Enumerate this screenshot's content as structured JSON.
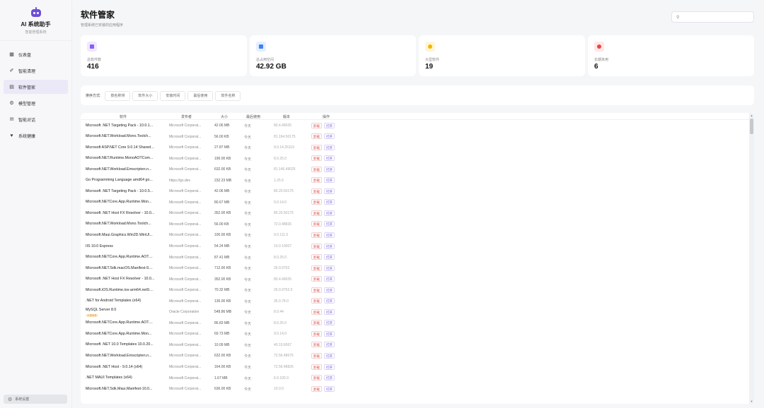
{
  "brand": {
    "title": "AI 系统助手",
    "subtitle": "智能管理系统"
  },
  "sidebar": {
    "items": [
      {
        "label": "仪表盘",
        "icon": "dashboard-icon",
        "active": false
      },
      {
        "label": "智能清理",
        "icon": "broom-icon",
        "active": false
      },
      {
        "label": "软件管家",
        "icon": "package-icon",
        "active": true
      },
      {
        "label": "模型管理",
        "icon": "model-icon",
        "active": false
      },
      {
        "label": "智能对话",
        "icon": "chat-icon",
        "active": false
      },
      {
        "label": "系统健康",
        "icon": "heartbeat-icon",
        "active": false
      }
    ],
    "settings_label": "系统设置"
  },
  "header": {
    "title": "软件管家",
    "subtitle": "管理系统已安装的应用程序"
  },
  "search": {
    "placeholder": ""
  },
  "stats": [
    {
      "label": "总软件数",
      "value": "416",
      "icon": "software-count-icon",
      "color": "#8b5cf6",
      "bg": "#efe9fd"
    },
    {
      "label": "总占用空间",
      "value": "42.92 GB",
      "icon": "disk-usage-icon",
      "color": "#3b82f6",
      "bg": "#e6efff"
    },
    {
      "label": "大型软件",
      "value": "19",
      "icon": "large-software-icon",
      "color": "#f5b400",
      "bg": "#fff5d9"
    },
    {
      "label": "长期未用",
      "value": "6",
      "icon": "unused-software-icon",
      "color": "#ef4444",
      "bg": "#fde8e8"
    }
  ],
  "filter": {
    "label": "排序方式:",
    "options": [
      "按名称排",
      "软件大小",
      "安装时间",
      "最后使用",
      "软件名称"
    ]
  },
  "table": {
    "headers": [
      "软件",
      "发布者",
      "大小",
      "最后使用",
      "版本",
      "操作"
    ],
    "uninstall_label": "卸载",
    "open_label": "打开",
    "rows": [
      {
        "name": "Microsoft .NET Targeting Pack - 10.0.1...",
        "publisher": "Microsoft Corporat...",
        "size": "42.06 MB",
        "last_used": "今天",
        "version": "80.4.49025"
      },
      {
        "name": "Microsoft.NET.Workload.Mono.Toolch...",
        "publisher": "Microsoft Corporat...",
        "size": "56.00 KB",
        "last_used": "今天",
        "version": "81.164.50175"
      },
      {
        "name": "Microsoft ASP.NET Core 9.0.14 Shared...",
        "publisher": "Microsoft Corporat...",
        "size": "27.87 MB",
        "last_used": "今天",
        "version": "9.0.14.26119"
      },
      {
        "name": "Microsoft.NET.Runtime.MonoAOTCom...",
        "publisher": "Microsoft Corporat...",
        "size": "196.00 KB",
        "last_used": "今天",
        "version": "8.0.25.0"
      },
      {
        "name": "Microsoft.NET.Workload.Emscripten.n...",
        "publisher": "Microsoft Corporat...",
        "size": "632.00 KB",
        "last_used": "今天",
        "version": "81.146.49025"
      },
      {
        "name": "Go Programming Language amd64 go...",
        "publisher": "https://go.dev",
        "size": "232.23 MB",
        "last_used": "今天",
        "version": "1.25.5"
      },
      {
        "name": "Microsoft .NET Targeting Pack - 10.0.5...",
        "publisher": "Microsoft Corporat...",
        "size": "42.06 MB",
        "last_used": "今天",
        "version": "80.20.50175"
      },
      {
        "name": "Microsoft.NETCore.App.Runtime.Mon...",
        "publisher": "Microsoft Corporat...",
        "size": "80.67 MB",
        "last_used": "今天",
        "version": "9.0.14.0"
      },
      {
        "name": "Microsoft .NET Host FX Resolver - 10.0...",
        "publisher": "Microsoft Corporat...",
        "size": "352.00 KB",
        "last_used": "今天",
        "version": "80.20.50175"
      },
      {
        "name": "Microsoft.NET.Workload.Mono.Toolch...",
        "publisher": "Microsoft Corporat...",
        "size": "56.00 KB",
        "last_used": "今天",
        "version": "72.0.48826"
      },
      {
        "name": "Microsoft.Maui.Graphics.Win2D.WinUI...",
        "publisher": "Microsoft Corporat...",
        "size": "100.00 KB",
        "last_used": "今天",
        "version": "9.0.111.0"
      },
      {
        "name": "IIS 10.0 Express",
        "publisher": "Microsoft Corporat...",
        "size": "54.24 MB",
        "last_used": "今天",
        "version": "10.0.10007"
      },
      {
        "name": "Microsoft.NETCore.App.Runtime.AOT....",
        "publisher": "Microsoft Corporat...",
        "size": "87.41 MB",
        "last_used": "今天",
        "version": "8.0.25.0"
      },
      {
        "name": "Microsoft.NET.Sdk.macOS.Manifest-9....",
        "publisher": "Microsoft Corporat...",
        "size": "712.00 KB",
        "last_used": "今天",
        "version": "26.0.9752"
      },
      {
        "name": "Microsoft .NET Host FX Resolver - 10.0...",
        "publisher": "Microsoft Corporat...",
        "size": "352.00 KB",
        "last_used": "今天",
        "version": "80.4.49025"
      },
      {
        "name": "Microsoft.iOS.Runtime.ios-arm64.net9....",
        "publisher": "Microsoft Corporat...",
        "size": "70.32 MB",
        "last_used": "今天",
        "version": "26.0.9752.0"
      },
      {
        "name": ".NET for Android Templates (x64)",
        "publisher": "Microsoft Corporat...",
        "size": "136.00 KB",
        "last_used": "今天",
        "version": "35.0.78.0"
      },
      {
        "name": "MySQL Server 8.0",
        "publisher": "Oracle Corporation",
        "size": "548.86 MB",
        "last_used": "今天",
        "version": "8.0.44",
        "tag": "大型软件"
      },
      {
        "name": "Microsoft.NETCore.App.Runtime.AOT....",
        "publisher": "Microsoft Corporat...",
        "size": "86.83 MB",
        "last_used": "今天",
        "version": "8.0.25.0"
      },
      {
        "name": "Microsoft.NETCore.App.Runtime.Mon...",
        "publisher": "Microsoft Corporat...",
        "size": "69.73 MB",
        "last_used": "今天",
        "version": "9.0.14.0"
      },
      {
        "name": "Microsoft .NET 10.0 Templates 10.0.20...",
        "publisher": "Microsoft Corporat...",
        "size": "10.09 MB",
        "last_used": "今天",
        "version": "40.10.6067"
      },
      {
        "name": "Microsoft.NET.Workload.Emscripten.n...",
        "publisher": "Microsoft Corporat...",
        "size": "632.00 KB",
        "last_used": "今天",
        "version": "72.56.48675"
      },
      {
        "name": "Microsoft .NET Host - 9.0.14 (x64)",
        "publisher": "Microsoft Corporat...",
        "size": "164.00 KB",
        "last_used": "今天",
        "version": "72.56.48826"
      },
      {
        "name": ".NET MAUI Templates (x64)",
        "publisher": "Microsoft Corporat...",
        "size": "1.67 MB",
        "last_used": "今天",
        "version": "6.0.100.0"
      },
      {
        "name": "Microsoft.NET.Sdk.Maui.Manifest-10.0...",
        "publisher": "Microsoft Corporat...",
        "size": "636.00 KB",
        "last_used": "今天",
        "version": "10.0.0"
      }
    ]
  }
}
